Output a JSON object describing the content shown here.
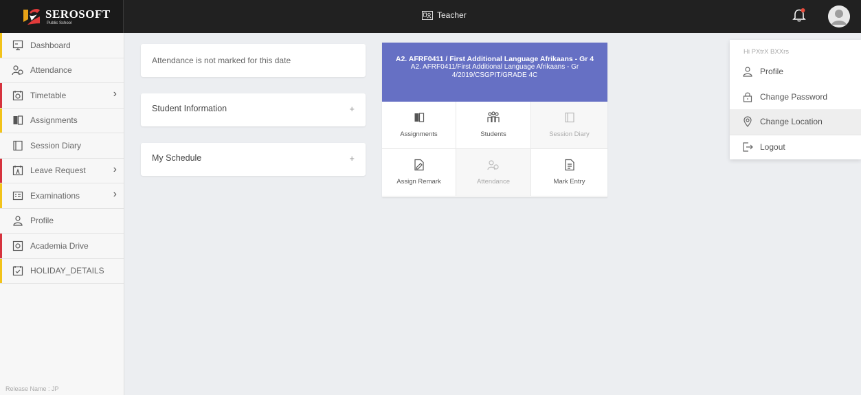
{
  "brand": {
    "name": "SEROSOFT",
    "tagline": "Public School"
  },
  "header": {
    "role_label": "Teacher",
    "icons": [
      "teacher-badge-icon",
      "bell-icon",
      "avatar-icon"
    ]
  },
  "sidebar": {
    "items": [
      {
        "label": "Dashboard",
        "icon": "dashboard-icon",
        "accent": "#f2c31a",
        "has_submenu": false
      },
      {
        "label": "Attendance",
        "icon": "attendance-icon",
        "accent": "",
        "has_submenu": false
      },
      {
        "label": "Timetable",
        "icon": "timetable-icon",
        "accent": "#d6333e",
        "has_submenu": true
      },
      {
        "label": "Assignments",
        "icon": "assignments-icon",
        "accent": "#f2c31a",
        "has_submenu": false
      },
      {
        "label": "Session Diary",
        "icon": "session-diary-icon",
        "accent": "",
        "has_submenu": false
      },
      {
        "label": "Leave Request",
        "icon": "leave-request-icon",
        "accent": "#d6333e",
        "has_submenu": true
      },
      {
        "label": "Examinations",
        "icon": "examinations-icon",
        "accent": "#f2c31a",
        "has_submenu": true
      },
      {
        "label": "Profile",
        "icon": "profile-icon",
        "accent": "",
        "has_submenu": false
      },
      {
        "label": "Academia Drive",
        "icon": "academia-drive-icon",
        "accent": "#d6333e",
        "has_submenu": false
      },
      {
        "label": "HOLIDAY_DETAILS",
        "icon": "holiday-details-icon",
        "accent": "#f2c31a",
        "has_submenu": false
      }
    ],
    "release_label": "Release Name : JP"
  },
  "main": {
    "attendance_notice": "Attendance is not marked for this date",
    "accordions": [
      {
        "label": "Student Information",
        "icon": "plus-icon"
      },
      {
        "label": "My Schedule",
        "icon": "plus-icon"
      }
    ],
    "subject_card": {
      "title": "A2. AFRF0411 / First Additional Language Afrikaans - Gr 4",
      "subtitle": "A2. AFRF0411/First Additional Language Afrikaans - Gr 4/2019/CSGPIT/GRADE 4C",
      "header_color": "#6670c4",
      "actions": [
        {
          "label": "Assignments",
          "icon": "assignments-icon",
          "enabled": true
        },
        {
          "label": "Students",
          "icon": "students-icon",
          "enabled": true
        },
        {
          "label": "Session Diary",
          "icon": "session-diary-icon",
          "enabled": false
        },
        {
          "label": "Assign Remark",
          "icon": "assign-remark-icon",
          "enabled": true
        },
        {
          "label": "Attendance",
          "icon": "attendance-icon",
          "enabled": false
        },
        {
          "label": "Mark Entry",
          "icon": "mark-entry-icon",
          "enabled": true
        }
      ]
    }
  },
  "user_menu": {
    "greeting": "Hi PXtrX BXXrs",
    "items": [
      {
        "label": "Profile",
        "icon": "profile-icon"
      },
      {
        "label": "Change Password",
        "icon": "lock-icon"
      },
      {
        "label": "Change Location",
        "icon": "location-pin-icon",
        "active": true
      },
      {
        "label": "Logout",
        "icon": "logout-icon"
      }
    ]
  },
  "colors": {
    "topbar": "#212121",
    "accent_yellow": "#f2c31a",
    "accent_red": "#d6333e",
    "card_header": "#6670c4"
  }
}
